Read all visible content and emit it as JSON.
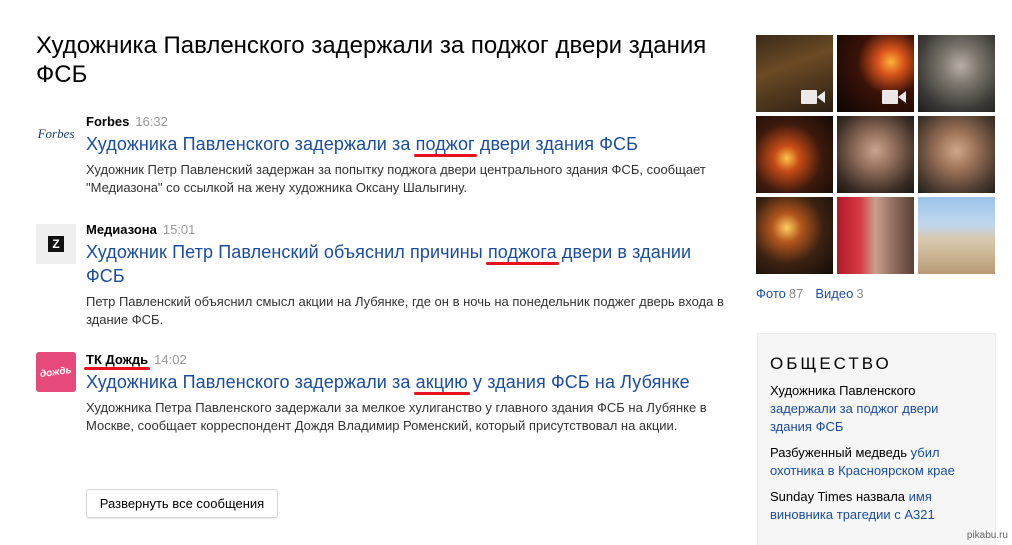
{
  "title": "Художника Павленского задержали за поджог двери здания ФСБ",
  "stories": [
    {
      "logo_text": "Forbes",
      "source": "Forbes",
      "time": "16:32",
      "headline_before": "Художника Павленского задержали за ",
      "headline_mark": "поджог",
      "headline_after": " двери здания ФСБ",
      "snippet": "Художник Петр Павленский задержан за попытку поджога двери центрального здания ФСБ, сообщает \"Медиазона\" со ссылкой на жену художника Оксану Шалыгину."
    },
    {
      "logo_text": "Z",
      "source": "Медиазона",
      "time": "15:01",
      "headline_before": "Художник Петр Павленский объяснил причины ",
      "headline_mark": "поджога",
      "headline_after": " двери в здании ФСБ",
      "snippet": "Петр Павленский объяснил смысл акции на Лубянке, где он в ночь на понедельник поджег дверь входа в здание ФСБ."
    },
    {
      "logo_text": "дождь",
      "source": "ТК Дождь",
      "time": "14:02",
      "headline_before": "Художника Павленского задержали за ",
      "headline_mark": "акцию",
      "headline_after": " у здания ФСБ на Лубянке",
      "snippet": "Художника Петра Павленского задержали за мелкое хулиганство у главного здания ФСБ на Лубянке в Москве, сообщает корреспондент Дождя Владимир Роменский, который присутствовал на акции."
    }
  ],
  "expand_label": "Развернуть все сообщения",
  "media": {
    "photo_label": "Фото",
    "photo_count": "87",
    "video_label": "Видео",
    "video_count": "3",
    "thumbnails": [
      {
        "video": true
      },
      {
        "video": true
      },
      {
        "video": false
      },
      {
        "video": false
      },
      {
        "video": false
      },
      {
        "video": false
      },
      {
        "video": false
      },
      {
        "video": false
      },
      {
        "video": false
      }
    ]
  },
  "society": {
    "heading": "ОБЩЕСТВО",
    "items": [
      {
        "plain": "Художника Павленского",
        "link": "задержали за поджог двери здания ФСБ"
      },
      {
        "plain": "Разбуженный медведь",
        "link": "убил охотника в Красноярском крае"
      },
      {
        "plain": "Sunday Times назвала",
        "link": "имя виновника трагедии с А321"
      }
    ]
  },
  "watermark": "pikabu.ru",
  "colors": {
    "link": "#1a4d9c",
    "highlight_underline": "#e8101e"
  }
}
